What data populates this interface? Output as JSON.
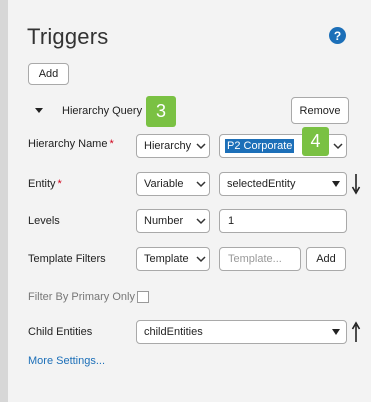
{
  "header": {
    "title": "Triggers",
    "help_icon": "?"
  },
  "actions": {
    "add_label": "Add"
  },
  "hierarchy_query": {
    "section_label": "Hierarchy Query",
    "remove_label": "Remove",
    "callouts": {
      "first": "3",
      "second": "4"
    }
  },
  "form": {
    "hierarchy_name": {
      "label": "Hierarchy Name",
      "required_mark": "*",
      "type_value": "Hierarchy",
      "value": "P2 Corporate"
    },
    "entity": {
      "label": "Entity",
      "required_mark": "*",
      "type_value": "Variable",
      "value": "selectedEntity"
    },
    "levels": {
      "label": "Levels",
      "type_value": "Number",
      "value": "1"
    },
    "template_filters": {
      "label": "Template Filters",
      "type_value": "Template",
      "placeholder": "Template...",
      "add_label": "Add"
    },
    "filter_primary": {
      "label": "Filter By Primary Only",
      "checked": false
    },
    "child_entities": {
      "label": "Child Entities",
      "value": "childEntities"
    }
  },
  "footer": {
    "more_settings_label": "More Settings..."
  }
}
